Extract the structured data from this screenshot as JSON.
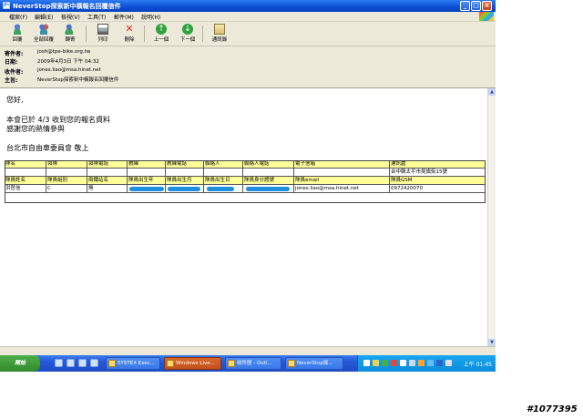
{
  "window": {
    "title": "NeverStop探索新中橫報名回覆信件"
  },
  "menu": [
    "檔案(F)",
    "編輯(E)",
    "檢視(V)",
    "工具(T)",
    "郵件(M)",
    "說明(H)"
  ],
  "toolbar": {
    "reply": "回覆",
    "reply_all": "全部回覆",
    "forward": "轉寄",
    "print": "列印",
    "delete": "刪除",
    "previous": "上一個",
    "next": "下一個",
    "addresses": "通訊錄"
  },
  "headers": [
    {
      "label": "寄件者:",
      "value": "josh@tpe-bike.org.tw"
    },
    {
      "label": "日期:",
      "value": "2009年4月3日 下午 04:32"
    },
    {
      "label": "收件者:",
      "value": "jones.liao@msa.hinet.net"
    },
    {
      "label": "主旨:",
      "value": "NeverStop探索新中橫報名回覆信件"
    }
  ],
  "message": {
    "greeting": "您好,",
    "line1": "本會已於 4/3 收到您的報名資料",
    "line2": "感謝您的熱情參與",
    "signature": "台北市自由車委員會 敬上"
  },
  "table": {
    "header1": [
      "隊名",
      "領隊",
      "領隊電話",
      "教練",
      "教練電話",
      "聯絡人",
      "聯絡人電話",
      "電子信箱",
      "通訊處"
    ],
    "row1": [
      "",
      "",
      "",
      "",
      "",
      "",
      "",
      "",
      "台中縣太平市吳旗街15號"
    ],
    "header2": [
      "隊員姓名",
      "隊員組別",
      "兩鐵站名",
      "隊員出生年",
      "隊員出生月",
      "隊員出生日",
      "隊員身分證號",
      "隊員email",
      "隊員GSM"
    ],
    "row2": [
      "洪哲信",
      "C",
      "無",
      "",
      "",
      "",
      "",
      "jones.liao@msa.hinet.net",
      "0972420070"
    ]
  },
  "taskbar": {
    "start": "開始",
    "tasks": [
      "SYSTEX Exec...",
      "Windows Live...",
      "收件匣 - Outl...",
      "NeverStop探..."
    ],
    "clock": "上午 01:45"
  },
  "watermark": "#1077395"
}
